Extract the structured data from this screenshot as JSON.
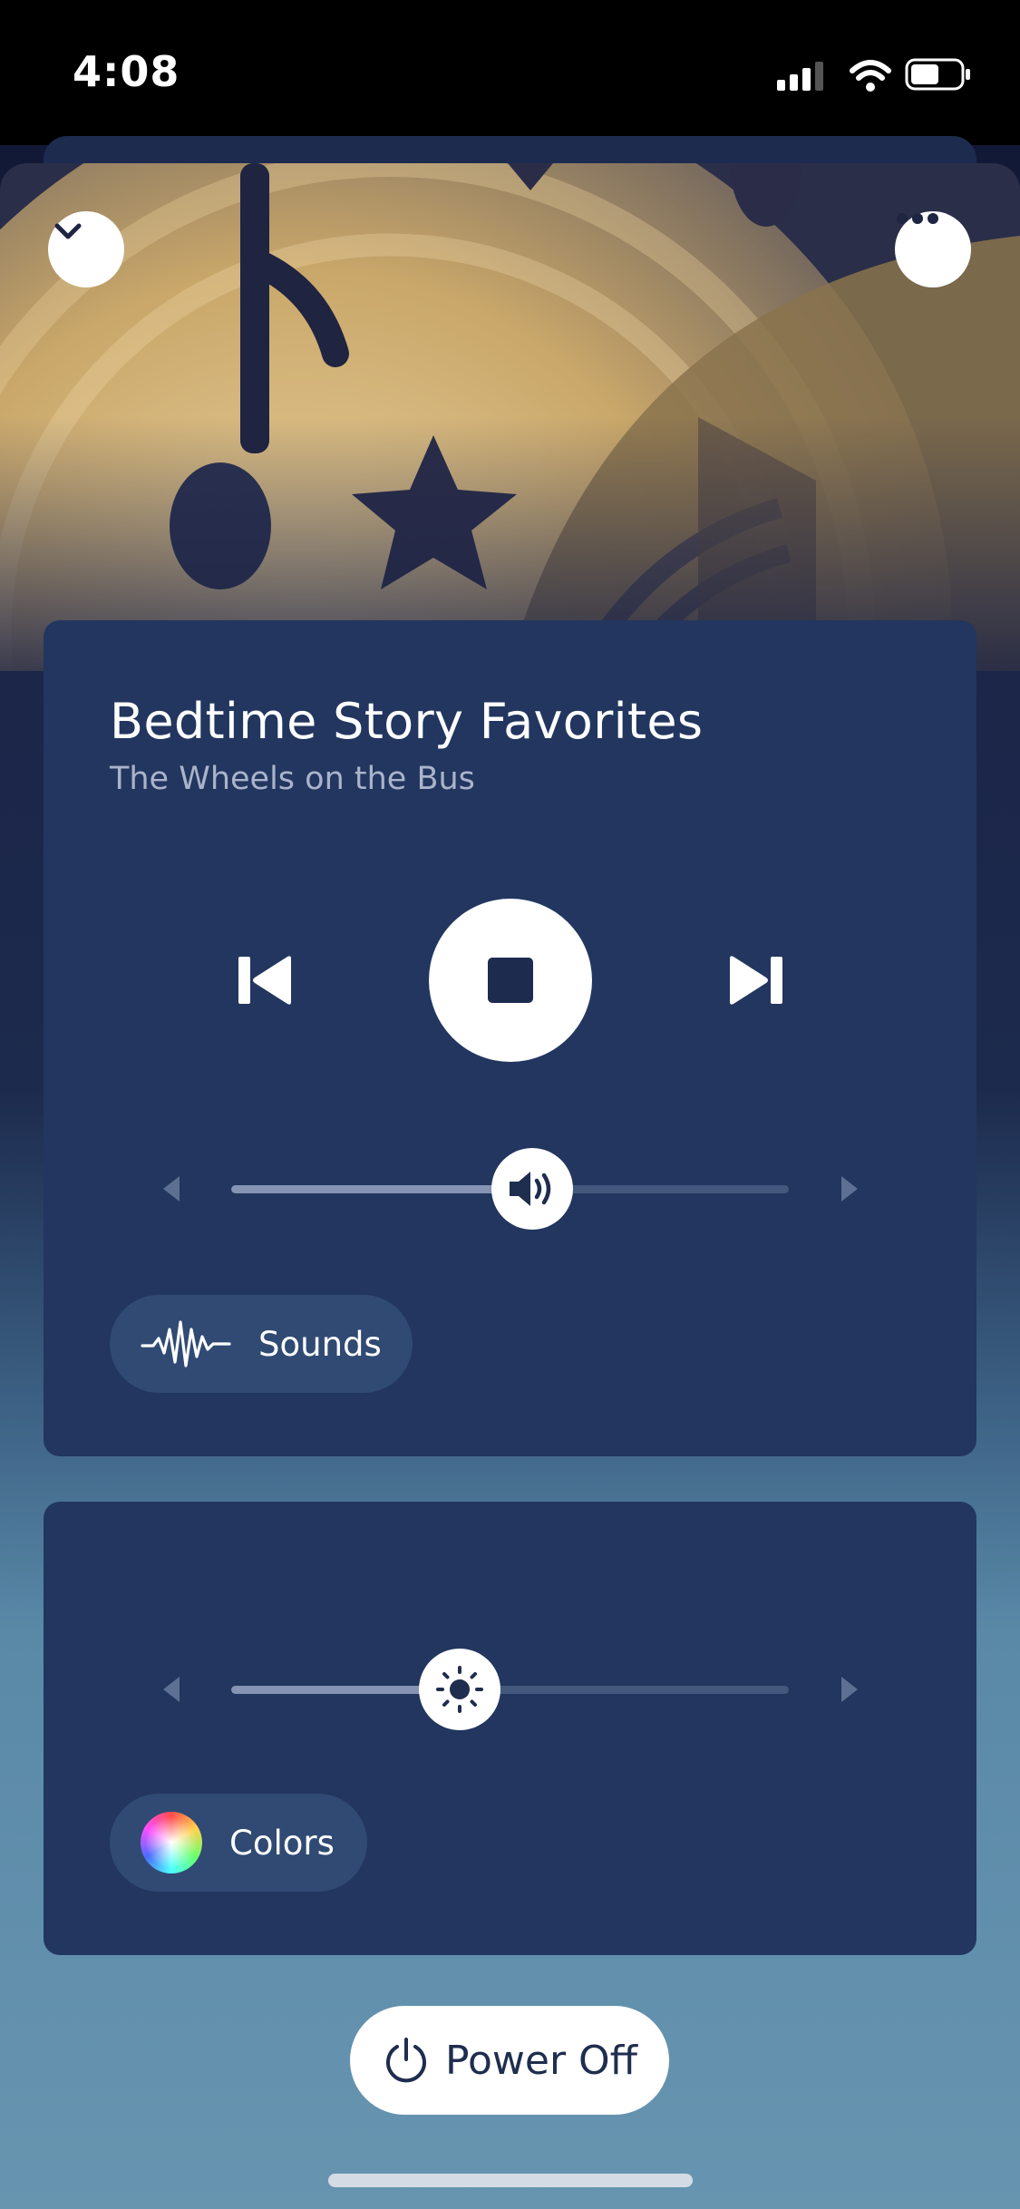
{
  "status_bar": {
    "time": "4:08"
  },
  "header": {
    "collapse_icon": "chevron-down-icon",
    "menu_icon": "more-dots-icon"
  },
  "player": {
    "title": "Bedtime Story Favorites",
    "subtitle": "The Wheels on the Bus",
    "controls": [
      "skip-previous-icon",
      "stop-icon",
      "skip-next-icon"
    ],
    "volume_level": 0.54,
    "sounds_label": "Sounds"
  },
  "light": {
    "brightness_level": 0.41,
    "colors_label": "Colors"
  },
  "power": {
    "label": "Power Off"
  },
  "colors": {
    "card": "#22365f",
    "pill": "#304a73",
    "accent_gold": "#c9a76a"
  }
}
